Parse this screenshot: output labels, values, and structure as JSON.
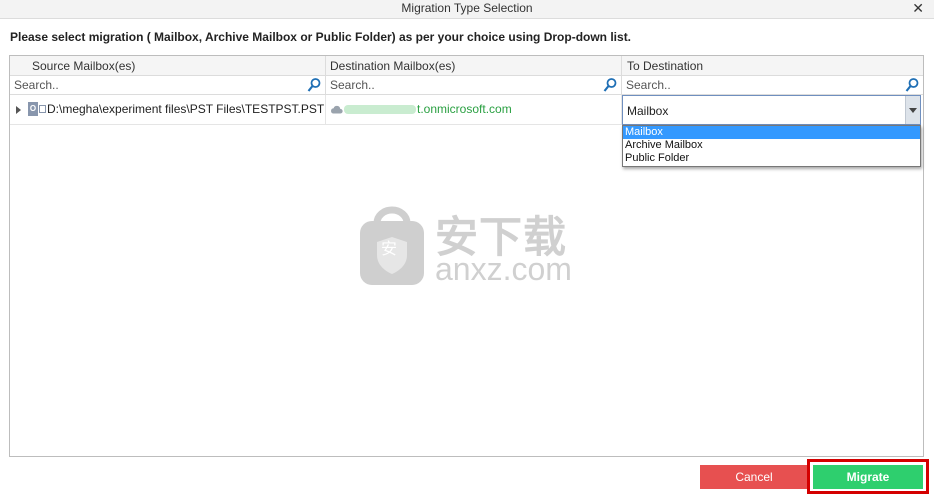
{
  "window": {
    "title": "Migration Type Selection",
    "close_glyph": "✕"
  },
  "instruction": "Please select migration ( Mailbox, Archive Mailbox or Public Folder) as per your choice using Drop-down list.",
  "grid": {
    "columns": [
      "Source Mailbox(es)",
      "Destination Mailbox(es)",
      "To Destination"
    ],
    "search_placeholders": [
      "Search..",
      "Search..",
      "Search.."
    ],
    "rows": [
      {
        "pst_badge": "O",
        "source": "D:\\megha\\experiment files\\PST Files\\TESTPST.PST",
        "destination_visible": "t.onmicrosoft.com",
        "to_destination": "Mailbox"
      }
    ]
  },
  "dropdown": {
    "options": [
      "Mailbox",
      "Archive Mailbox",
      "Public Folder"
    ],
    "selected_index": 0
  },
  "watermark": {
    "glyph": "安",
    "line1": "安下载",
    "line2": "anxz.com"
  },
  "buttons": {
    "cancel": "Cancel",
    "migrate": "Migrate"
  },
  "colors": {
    "cancel_bg": "#e75050",
    "migrate_bg": "#2ecf6e",
    "highlight_border": "#d40000",
    "selection_blue": "#3399ff",
    "email_green": "#2aa042"
  },
  "icons": [
    "close-icon",
    "search-icon",
    "expand-arrow-icon",
    "pst-file-icon",
    "cloud-icon",
    "dropdown-arrow-icon"
  ]
}
